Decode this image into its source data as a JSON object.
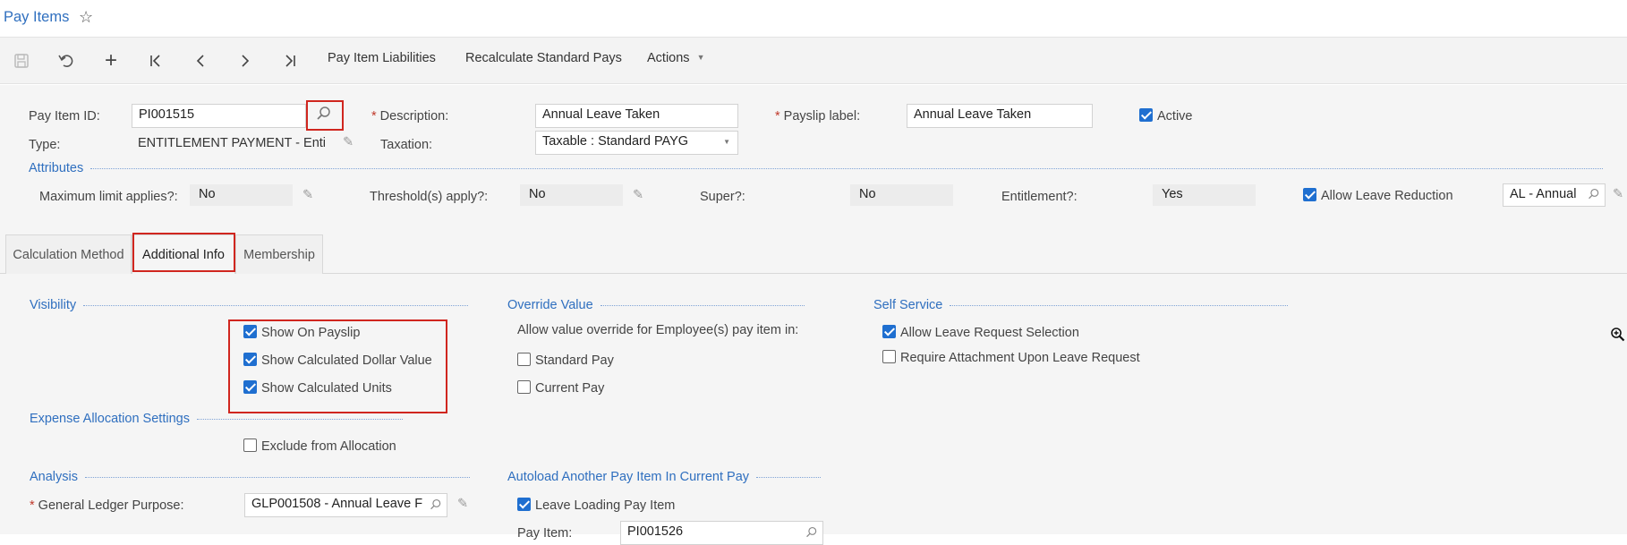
{
  "title": "Pay Items",
  "toolbar": {
    "liabilities": "Pay Item Liabilities",
    "recalculate": "Recalculate Standard Pays",
    "actions": "Actions"
  },
  "header": {
    "pay_item_id_label": "Pay Item ID:",
    "pay_item_id": "PI001515",
    "description_label": "Description:",
    "description": "Annual Leave Taken",
    "payslip_label_label": "Payslip label:",
    "payslip_label": "Annual Leave Taken",
    "active_label": "Active",
    "type_label": "Type:",
    "type": "ENTITLEMENT PAYMENT - Enti",
    "taxation_label": "Taxation:",
    "taxation": "Taxable : Standard PAYG"
  },
  "attributes": {
    "title": "Attributes",
    "max_limit_label": "Maximum limit applies?:",
    "max_limit": "No",
    "threshold_label": "Threshold(s) apply?:",
    "threshold": "No",
    "super_label": "Super?:",
    "super": "No",
    "entitlement_label": "Entitlement?:",
    "entitlement": "Yes",
    "allow_leave_reduction": "Allow Leave Reduction",
    "leave_type": "AL - Annual"
  },
  "tabs": [
    "Calculation Method",
    "Additional Info",
    "Membership"
  ],
  "visibility": {
    "title": "Visibility",
    "show_on_payslip": "Show On Payslip",
    "show_dollar": "Show Calculated Dollar Value",
    "show_units": "Show Calculated Units"
  },
  "expense": {
    "title": "Expense Allocation Settings",
    "exclude": "Exclude from Allocation"
  },
  "analysis": {
    "title": "Analysis",
    "gl_purpose_label": "General Ledger Purpose:",
    "gl_purpose": "GLP001508 - Annual Leave F"
  },
  "override": {
    "title": "Override Value",
    "description": "Allow value override for Employee(s) pay item in:",
    "standard_pay": "Standard Pay",
    "current_pay": "Current Pay"
  },
  "autoload": {
    "title": "Autoload Another Pay Item In Current Pay",
    "leave_loading": "Leave Loading Pay Item",
    "pay_item_label": "Pay Item:",
    "pay_item": "PI001526"
  },
  "self_service": {
    "title": "Self Service",
    "allow_leave_request": "Allow Leave Request Selection",
    "require_attachment": "Require Attachment Upon Leave Request"
  }
}
